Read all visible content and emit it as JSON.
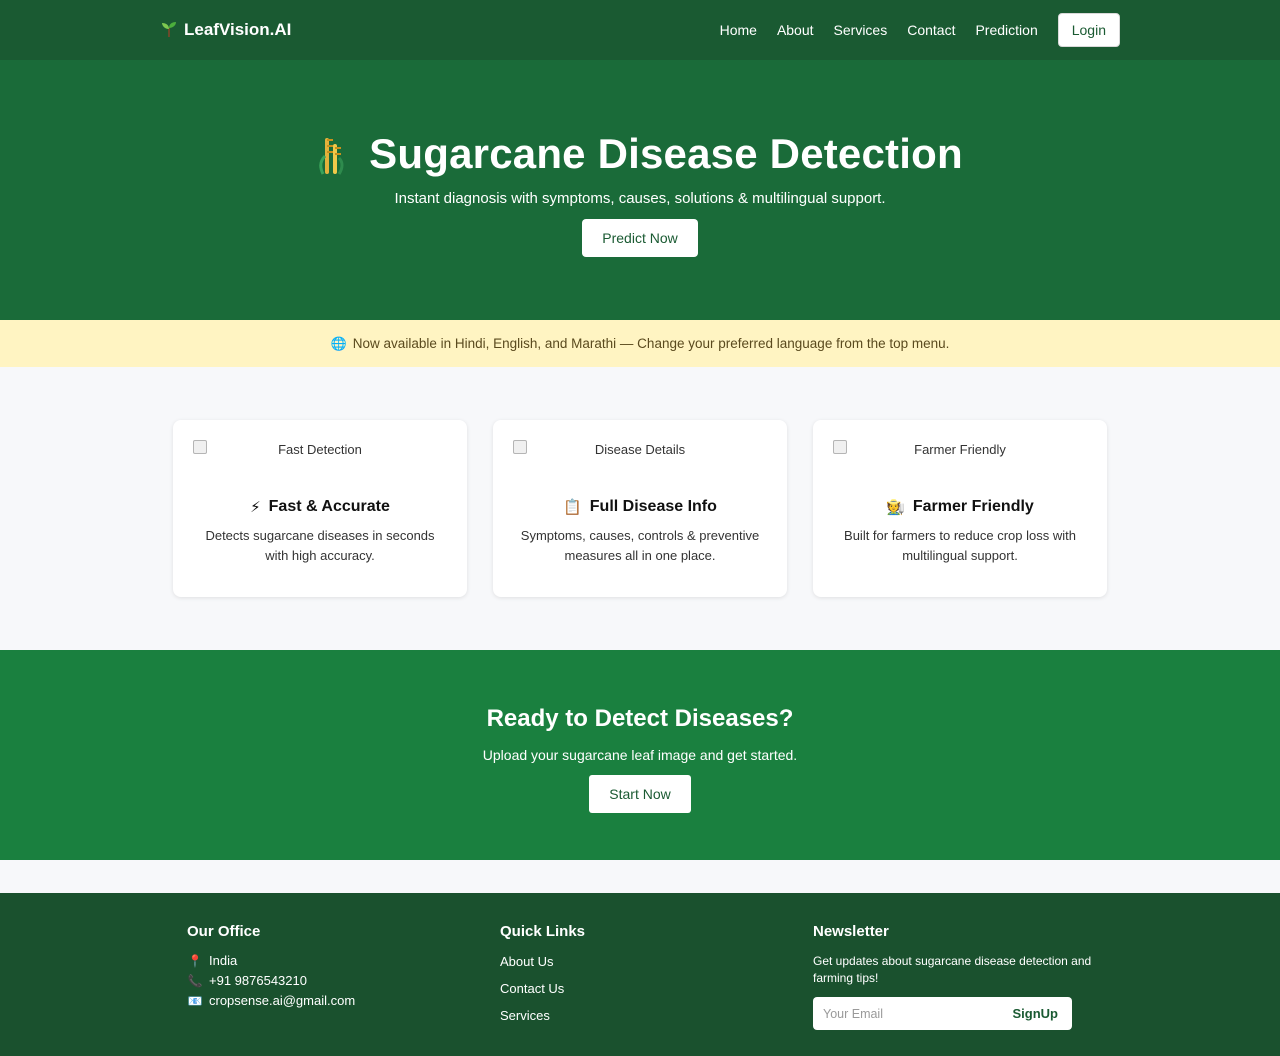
{
  "nav": {
    "brand_icon": "sprout-icon",
    "brand": "LeafVision.AI",
    "links": [
      "Home",
      "About",
      "Services",
      "Contact",
      "Prediction"
    ],
    "login": "Login"
  },
  "hero": {
    "icon": "sugarcane-icon",
    "title": "Sugarcane Disease Detection",
    "subtitle": "Instant diagnosis with symptoms, causes, solutions & multilingual support.",
    "cta": "Predict Now"
  },
  "notice": {
    "icon": "globe-icon",
    "text": "Now available in Hindi, English, and Marathi — Change your preferred language from the top menu."
  },
  "features": [
    {
      "img_alt": "Fast Detection",
      "icon": "lightning-icon",
      "title": "Fast & Accurate",
      "desc": "Detects sugarcane diseases in seconds with high accuracy."
    },
    {
      "img_alt": "Disease Details",
      "icon": "clipboard-icon",
      "title": "Full Disease Info",
      "desc": "Symptoms, causes, controls & preventive measures all in one place."
    },
    {
      "img_alt": "Farmer Friendly",
      "icon": "farmer-icon",
      "title": "Farmer Friendly",
      "desc": "Built for farmers to reduce crop loss with multilingual support."
    }
  ],
  "cta": {
    "title": "Ready to Detect Diseases?",
    "subtitle": "Upload your sugarcane leaf image and get started.",
    "button": "Start Now"
  },
  "footer": {
    "office": {
      "title": "Our Office",
      "location": "India",
      "phone": "+91 9876543210",
      "email": "cropsense.ai@gmail.com"
    },
    "links": {
      "title": "Quick Links",
      "items": [
        "About Us",
        "Contact Us",
        "Services"
      ]
    },
    "newsletter": {
      "title": "Newsletter",
      "text": "Get updates about sugarcane disease detection and farming tips!",
      "placeholder": "Your Email",
      "button": "SignUp"
    }
  },
  "colors": {
    "nav_bg": "#1a5a32",
    "hero_bg": "#1a6b39",
    "notice_bg": "#fff4c2",
    "cta_bg": "#1a803f",
    "footer_bg": "#1a512e"
  }
}
